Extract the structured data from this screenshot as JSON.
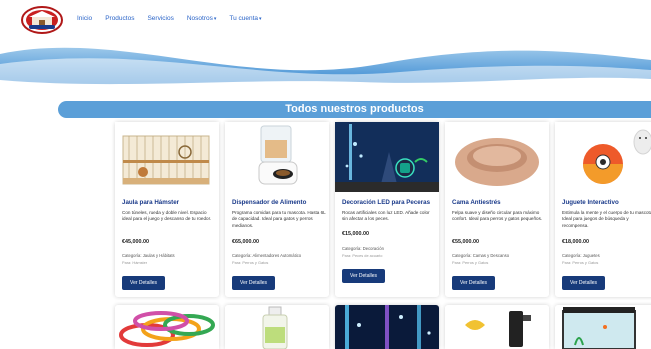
{
  "nav": {
    "logo_icon": "store-logo-icon",
    "links": [
      "Inicio",
      "Productos",
      "Servicios",
      "Nosotros",
      "Tu cuenta"
    ]
  },
  "banner": {
    "title": "Todos nuestros productos"
  },
  "products": [
    {
      "title": "Jaula para Hámster",
      "description": "Con túneles, rueda y doble nivel. Espacio ideal para el juego y descanso de tu roedor.",
      "price": "€45,000.00",
      "category": "Categoría: Jaulas y Hábitats",
      "for": "Para: Hámster",
      "button": "Ver Detalles"
    },
    {
      "title": "Dispensador de Alimento",
      "description": "Programa comidas para tu mascota. Hasta 6L de capacidad. Ideal para gatos y perros medianos.",
      "price": "€65,000.00",
      "category": "Categoría: Alimentadores Automático",
      "for": "Para: Perros y Gatos",
      "button": "Ver Detalles"
    },
    {
      "title": "Decoración LED para Peceras",
      "description": "Rocas artificiales con luz LED. Añade color sin afectar a los peces.",
      "price": "€15,000.00",
      "category": "Categoría: Decoración",
      "for": "Para: Peces de acuario",
      "button": "Ver Detalles"
    },
    {
      "title": "Cama Antiestrés",
      "description": "Felpa suave y diseño circular para máximo confort. Ideal para perros y gatos pequeños.",
      "price": "€55,000.00",
      "category": "Categoría: Camas y Descanso",
      "for": "Para: Perros y Gatos",
      "button": "Ver Detalles"
    },
    {
      "title": "Juguete Interactivo",
      "description": "Estimula la mente y el cuerpo de tu mascota. Ideal para juegos de búsqueda y recompensa.",
      "price": "€18,000.00",
      "category": "Categoría: Juguetes",
      "for": "Para: Perros y Gatos",
      "button": "Ver Detalles"
    }
  ],
  "colors": {
    "accent": "#5b9fd8",
    "button": "#173a7a",
    "title": "#1a3a8a",
    "nav_link": "#2a64c8"
  }
}
